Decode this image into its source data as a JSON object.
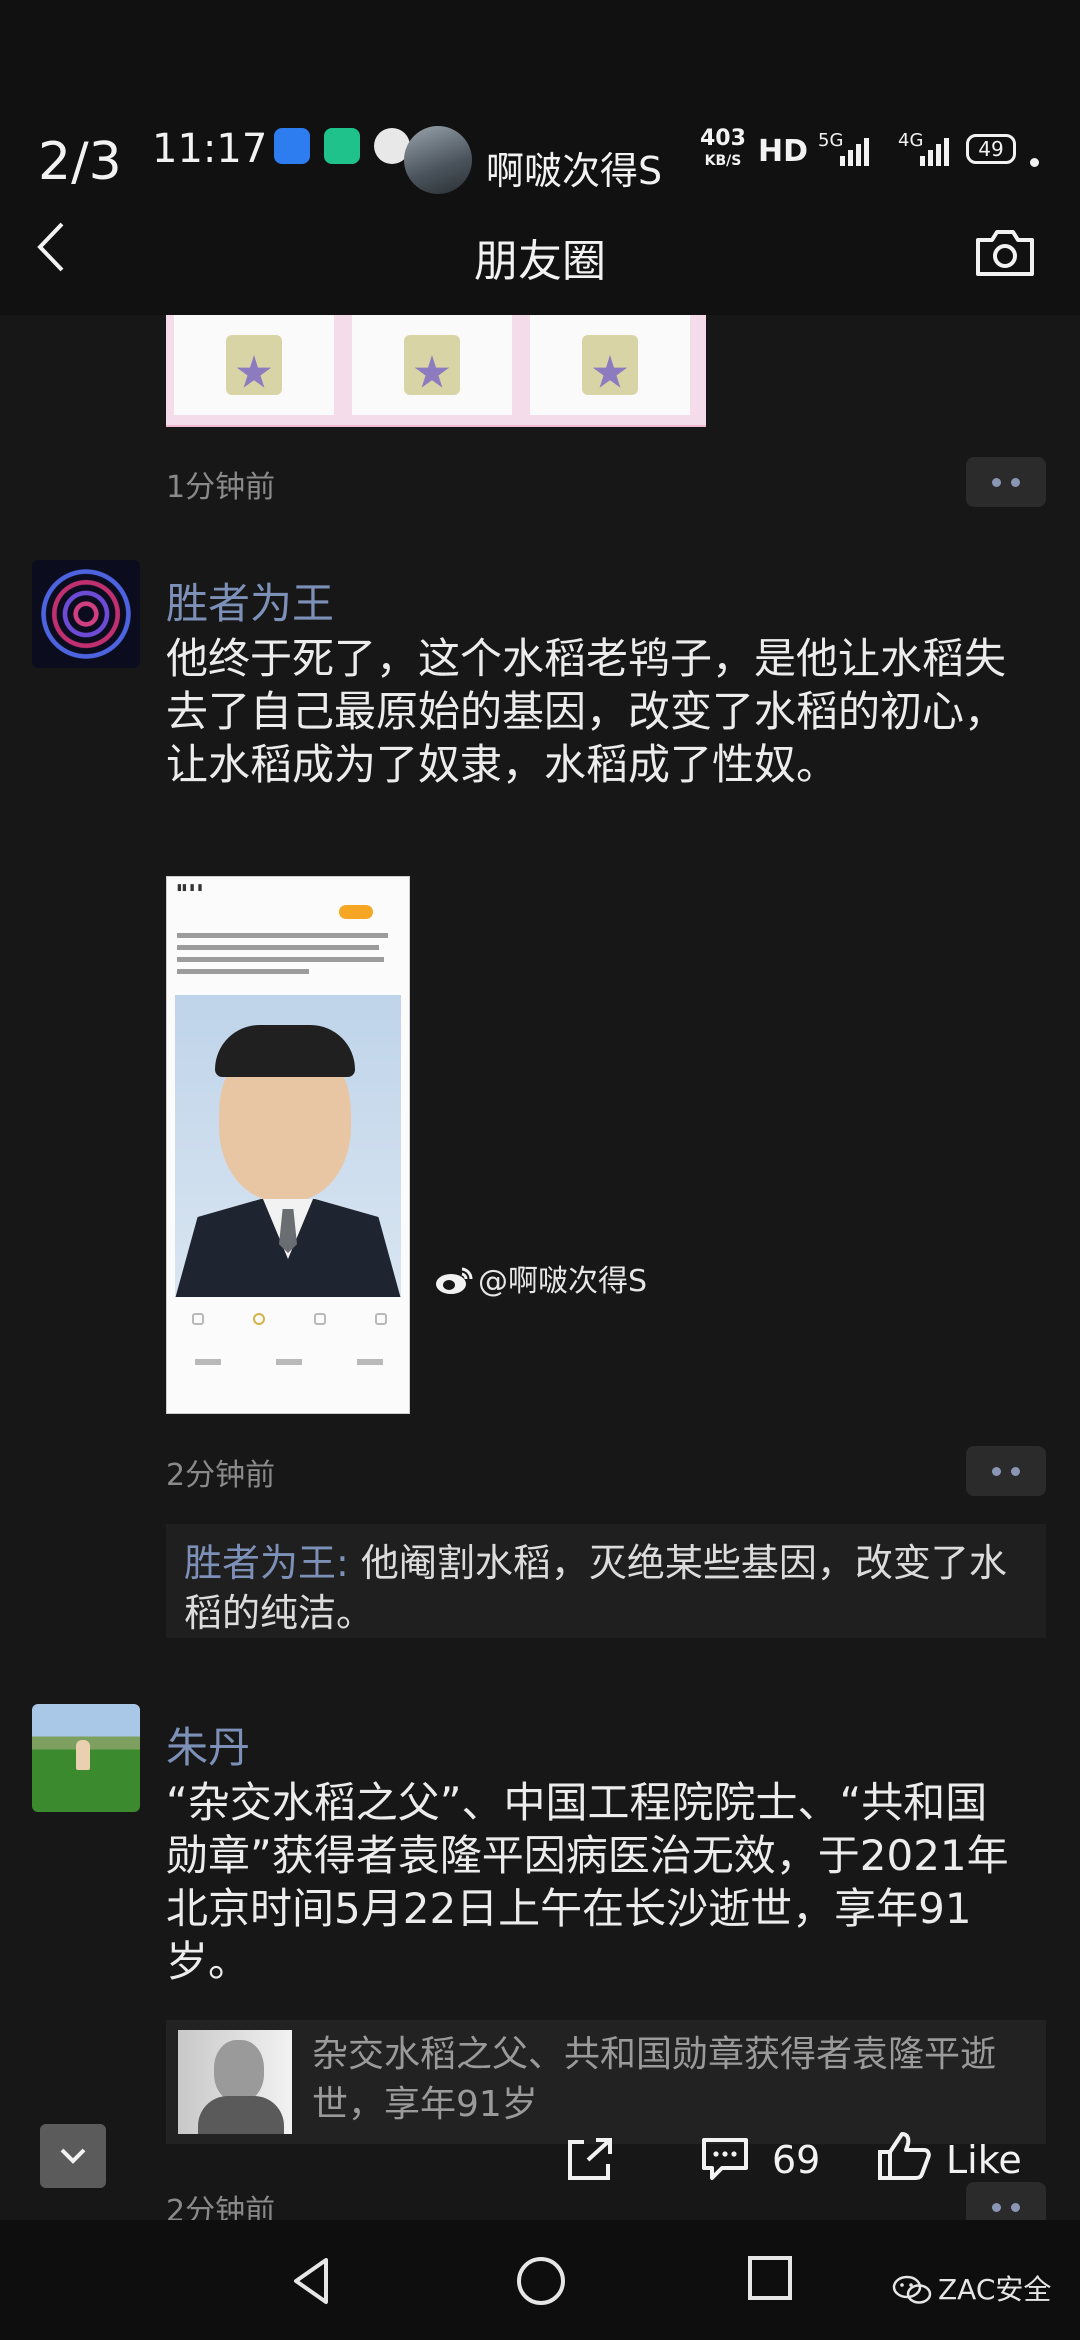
{
  "status_bar": {
    "page_indicator": "2/3",
    "time": "11:17",
    "weibo_user": "啊啵次得S",
    "net_speed": "403",
    "net_speed_unit": "KB/S",
    "hd_label": "HD",
    "signal_1": "5G",
    "signal_2": "4G",
    "battery": "49"
  },
  "header": {
    "title": "朋友圈"
  },
  "posts": [
    {
      "timestamp": "1分钟前"
    },
    {
      "username": "胜者为王",
      "text": "他终于死了，这个水稻老鸨子，是他让水稻失去了自己最原始的基因，改变了水稻的初心，让水稻成为了奴隶，水稻成了性奴。",
      "image_watermark": "@啊啵次得S",
      "timestamp": "2分钟前",
      "comment": {
        "author": "胜者为王:",
        "text": " 他阉割水稻，灭绝某些基因，改变了水稻的纯洁。"
      }
    },
    {
      "username": "朱丹",
      "text": "“杂交水稻之父”、中国工程院院士、“共和国勋章”获得者袁隆平因病医治无效，于2021年北京时间5月22日上午在长沙逝世，享年91岁。",
      "link_title": "杂交水稻之父、共和国勋章获得者袁隆平逝世，享年91岁",
      "timestamp": "2分钟前"
    }
  ],
  "action_bar": {
    "comment_count": "69",
    "like_label": "Like"
  },
  "footer": {
    "watermark": "ZAC安全"
  }
}
